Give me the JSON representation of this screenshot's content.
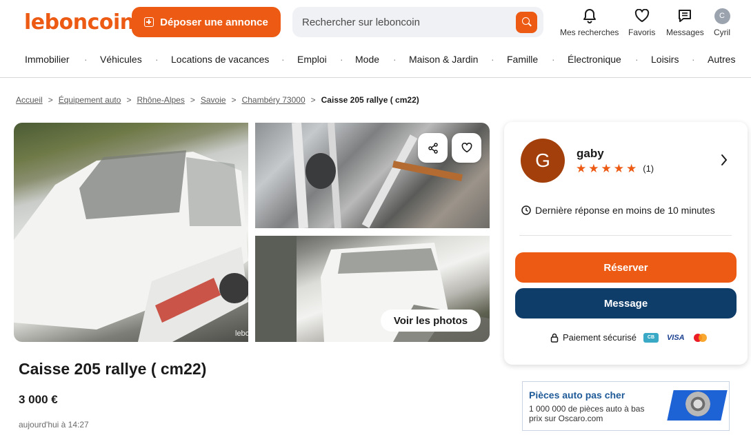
{
  "header": {
    "logo": "leboncoin",
    "deposit_label": "Déposer une annonce",
    "search_placeholder": "Rechercher sur leboncoin",
    "items": [
      {
        "label": "Mes recherches",
        "icon": "bell-icon"
      },
      {
        "label": "Favoris",
        "icon": "heart-icon"
      },
      {
        "label": "Messages",
        "icon": "message-icon"
      },
      {
        "label": "Cyril",
        "icon": "avatar-icon",
        "initial": "C"
      }
    ]
  },
  "categories": [
    "Immobilier",
    "Véhicules",
    "Locations de vacances",
    "Emploi",
    "Mode",
    "Maison & Jardin",
    "Famille",
    "Électronique",
    "Loisirs",
    "Autres"
  ],
  "breadcrumb": {
    "links": [
      "Accueil",
      "Équipement auto",
      "Rhône-Alpes",
      "Savoie",
      "Chambéry 73000"
    ],
    "current": "Caisse 205 rallye ( cm22)"
  },
  "gallery": {
    "watermark": "lebo",
    "see_photos": "Voir les photos"
  },
  "ad": {
    "title": "Caisse 205 rallye ( cm22)",
    "price": "3 000 €",
    "date": "aujourd'hui à 14:27"
  },
  "seller": {
    "initial": "G",
    "name": "gaby",
    "rating_stars": 5,
    "rating_count": "(1)",
    "response": "Dernière réponse en moins de 10 minutes",
    "reserve_label": "Réserver",
    "message_label": "Message",
    "secure_label": "Paiement sécurisé",
    "cb_label": "CB",
    "visa_label": "VISA"
  },
  "banner": {
    "title": "Pièces auto pas cher",
    "text": "1 000 000 de pièces auto à bas prix sur Oscaro.com"
  },
  "colors": {
    "brand": "#ec5a13",
    "message_button": "#0f3d6a",
    "avatar": "#a33f0a"
  }
}
